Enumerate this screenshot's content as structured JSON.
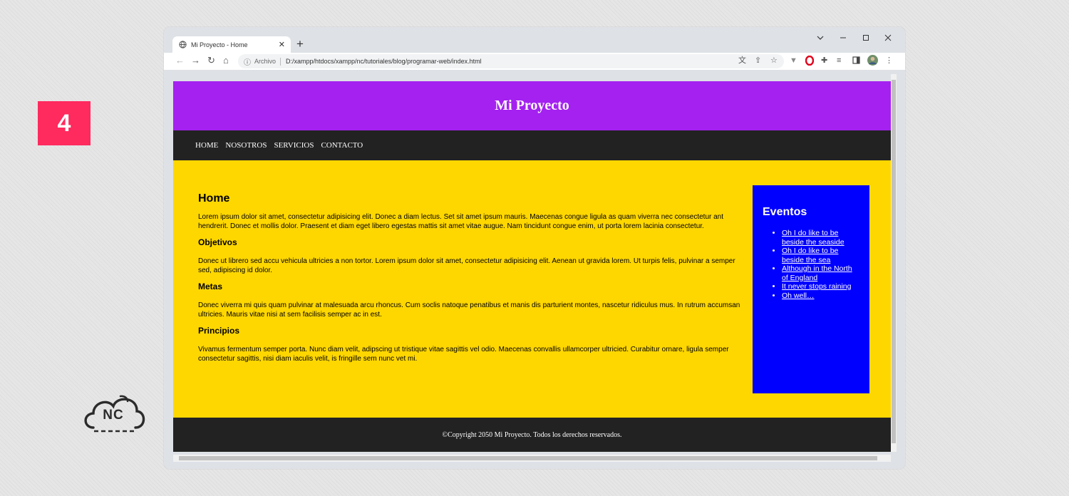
{
  "badge": {
    "number": "4",
    "color": "#ff2a5e"
  },
  "logo": {
    "text": "NC"
  },
  "browser": {
    "tab_title": "Mi Proyecto - Home",
    "address_prefix": "Archivo",
    "url": "D:/xampp/htdocs/xampp/nc/tutoriales/blog/programar-web/index.html",
    "icons": [
      "globe-icon",
      "close-icon",
      "plus-icon",
      "chevron-down-icon",
      "minimize-icon",
      "maximize-icon",
      "window-close-icon",
      "back-icon",
      "forward-icon",
      "reload-icon",
      "home-icon",
      "info-icon",
      "translate-icon",
      "share-icon",
      "star-icon",
      "extension-icon",
      "opera-icon",
      "puzzle-icon",
      "reading-list-icon",
      "sidepanel-icon",
      "avatar",
      "menu-icon"
    ]
  },
  "site": {
    "title": "Mi Proyecto",
    "nav": [
      "HOME",
      "NOSOTROS",
      "SERVICIOS",
      "CONTACTO"
    ],
    "main": {
      "heading": "Home",
      "intro": "Lorem ipsum dolor sit amet, consectetur adipisicing elit. Donec a diam lectus. Set sit amet ipsum mauris. Maecenas congue ligula as quam viverra nec consectetur ant hendrerit. Donec et mollis dolor. Praesent et diam eget libero egestas mattis sit amet vitae augue. Nam tincidunt congue enim, ut porta lorem lacinia consectetur.",
      "sections": [
        {
          "title": "Objetivos",
          "text": "Donec ut librero sed accu vehicula ultricies a non tortor. Lorem ipsum dolor sit amet, consectetur adipisicing elit. Aenean ut gravida lorem. Ut turpis felis, pulvinar a semper sed, adipiscing id dolor."
        },
        {
          "title": "Metas",
          "text": "Donec viverra mi quis quam pulvinar at malesuada arcu rhoncus. Cum soclis natoque penatibus et manis dis parturient montes, nascetur ridiculus mus. In rutrum accumsan ultricies. Mauris vitae nisi at sem facilisis semper ac in est."
        },
        {
          "title": "Principios",
          "text": "Vivamus fermentum semper porta. Nunc diam velit, adipscing ut tristique vitae sagittis vel odio. Maecenas convallis ullamcorper ultricied. Curabitur ornare, ligula semper consectetur sagittis, nisi diam iaculis velit, is fringille sem nunc vet mi."
        }
      ]
    },
    "aside": {
      "title": "Eventos",
      "items": [
        "Oh I do like to be beside the seaside",
        "Oh I do like to be beside the sea",
        "Although in the North of England",
        "It never stops raining",
        "Oh well…"
      ]
    },
    "footer": "©Copyright 2050 Mi Proyecto. Todos los derechos reservados.",
    "colors": {
      "header": "#a421f0",
      "nav": "#222222",
      "main": "#ffd700",
      "aside": "#0000ff",
      "footer": "#222222"
    }
  }
}
